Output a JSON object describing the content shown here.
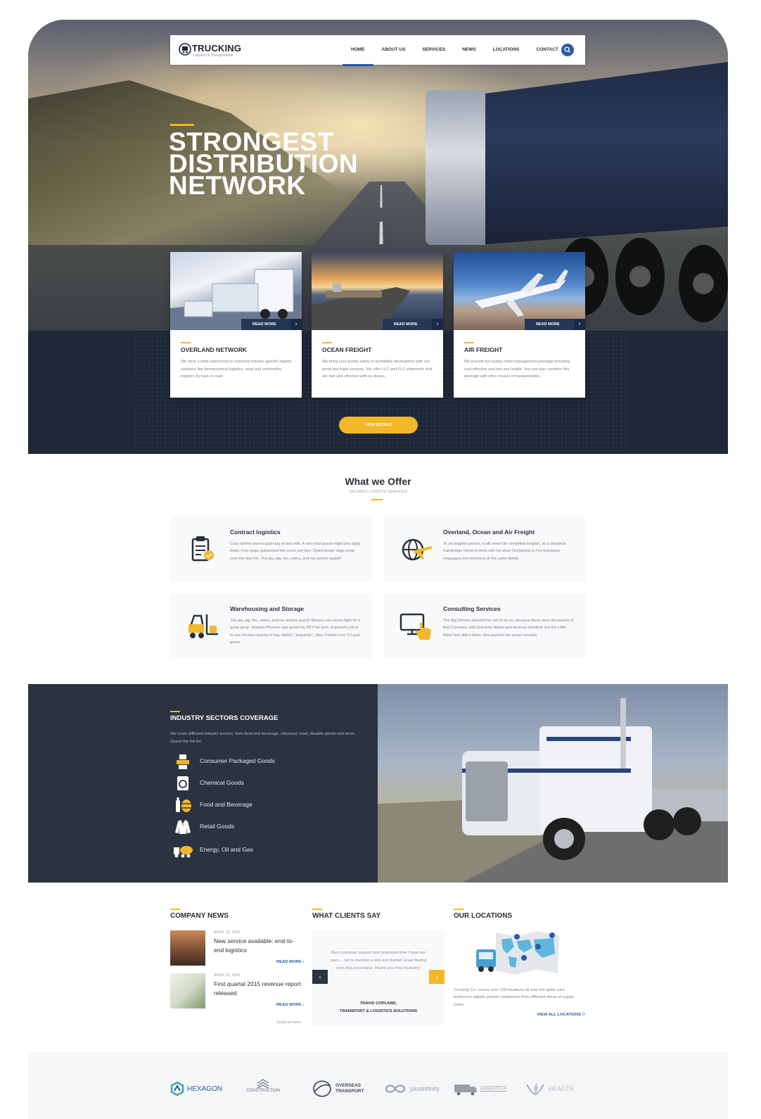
{
  "nav": {
    "logo_title": "TRUCKING",
    "logo_subtitle": "Logistics & Transportation",
    "items": [
      {
        "label": "HOME",
        "active": true
      },
      {
        "label": "ABOUT US",
        "active": false
      },
      {
        "label": "SERVICES",
        "active": false
      },
      {
        "label": "NEWS",
        "active": false
      },
      {
        "label": "LOCATIONS",
        "active": false
      },
      {
        "label": "CONTACT",
        "active": false
      }
    ],
    "search_icon": "search-icon"
  },
  "hero": {
    "title_lines": [
      "STRONGEST",
      "DISTRIBUTION",
      "NETWORK"
    ]
  },
  "services": [
    {
      "title": "OVERLAND NETWORK",
      "read_more": "READ MORE",
      "text": "We have a wide experience in overland industry specific logistic solutions like farmaceutical logistics, retail and automotive logistics by train or road."
    },
    {
      "title": "OCEAN FREIGHT",
      "read_more": "READ MORE",
      "text": "We bring your goods safely to worldwide destinations with our great sea fright services. We offer LLC and FLC shipments that are fast and effective with no delays."
    },
    {
      "title": "AIR FREIGHT",
      "read_more": "READ MORE",
      "text": "We provide full supply chain management package including cost effective and fast sea freight. You can also combine this package with other means of transportation."
    }
  ],
  "view_details": "VIEW DETAILS",
  "offer": {
    "title": "What we Offer",
    "subtitle": "TAILORED LOGISTIC SERVICES",
    "items": [
      {
        "title": "Contract logistics",
        "icon": "clipboard-check-icon",
        "text": "Cozy sphinx waves quart jug of bad milk. A very bad quack might jinx zippy fowls. Few quips galvanized the mock jury box. Quick brown dogs jump over the lazy fox. The jay, pig, fox, zebra, and my wolves quack!"
      },
      {
        "title": "Overland, Ocean and Air Freight",
        "icon": "globe-plane-icon",
        "text": "To an English person, it will seem like simplified English, as a skeptical Cambridge friend of mine told me what Occidental is.The European languages are members of the same family."
      },
      {
        "title": "Warehousing and Storage",
        "icon": "forklift-icon",
        "text": "The jay, pig, fox, zebra, and my wolves quack! Blowzy red vixens fight for a quick jump. Joaquin Phoenix was gazed by MTV for luck. A wizard's job is to vex chumps quickly in fog. Watch \"Jeopardy!\", Alex Trebek's fun TV quiz game."
      },
      {
        "title": "Consulting Services",
        "icon": "monitor-hand-icon",
        "text": "The Big Oxmox advised her not to do so, because there were thousands of bad Commas, wild Question Marks and devious Semikoli, but the Little Blind Text didn't listen. She packed her seven versalia."
      }
    ]
  },
  "industry": {
    "title": "INDUSTRY SECTORS COVERAGE",
    "description": "We cover different industrz sectors, from food and beverage, chemical, retail, durable goods and more. Check the full list.",
    "items": [
      {
        "label": "Consumer Packaged Goods",
        "icon": "packages-icon"
      },
      {
        "label": "Chemical Goods",
        "icon": "recycle-icon"
      },
      {
        "label": "Food and Beverage",
        "icon": "bottle-barrel-icon"
      },
      {
        "label": "Retail Goods",
        "icon": "jacket-icon"
      },
      {
        "label": "Energy, Oil and Gas",
        "icon": "tanker-truck-icon"
      }
    ]
  },
  "news": {
    "title": "COMPANY NEWS",
    "items": [
      {
        "date": "APRIL 22, 2015",
        "title": "New service available: end-to-end logistics",
        "more": "READ MORE"
      },
      {
        "date": "APRIL 22, 2015",
        "title": "First quartal 2015 revenue report released",
        "more": "READ MORE"
      }
    ],
    "all": "Read all news"
  },
  "clients": {
    "title": "WHAT CLIENTS SAY",
    "quote": "Best customer support and response time I have evr seen... not to mention a kick ass theme! Great feeling from this puurchase. Thank you Pixel Industry!",
    "author_name": "TRAVIS COPLAND,",
    "author_company": "TRANSPORT & LOGISTICS SOLUTIONS",
    "prev": "‹",
    "next": "›"
  },
  "locations": {
    "title": "OUR LOCATIONS",
    "text": "Trucking Co. covers over 150 locations all over the globe plus numerous logistic partner companies from different areas of supply chain.",
    "link": "VIEW ALL LOCATIONS"
  },
  "partners": [
    {
      "name": "HEXAGON",
      "icon": "hexagon-logo-icon"
    },
    {
      "name": "CONSTRUCTION",
      "icon": "construction-logo-icon"
    },
    {
      "name": "OVERSEAS TRANSPORT",
      "icon": "globe-logo-icon"
    },
    {
      "name": "plusinfinity",
      "icon": "infinity-logo-icon"
    },
    {
      "name": "LOGISTICS",
      "icon": "truck-logo-icon"
    },
    {
      "name": "HEALTH",
      "icon": "leaf-logo-icon"
    }
  ],
  "colors": {
    "accent": "#f3b72a",
    "primary": "#2a5ca8",
    "dark": "#1e2838",
    "industry_bg": "#2c3340"
  }
}
